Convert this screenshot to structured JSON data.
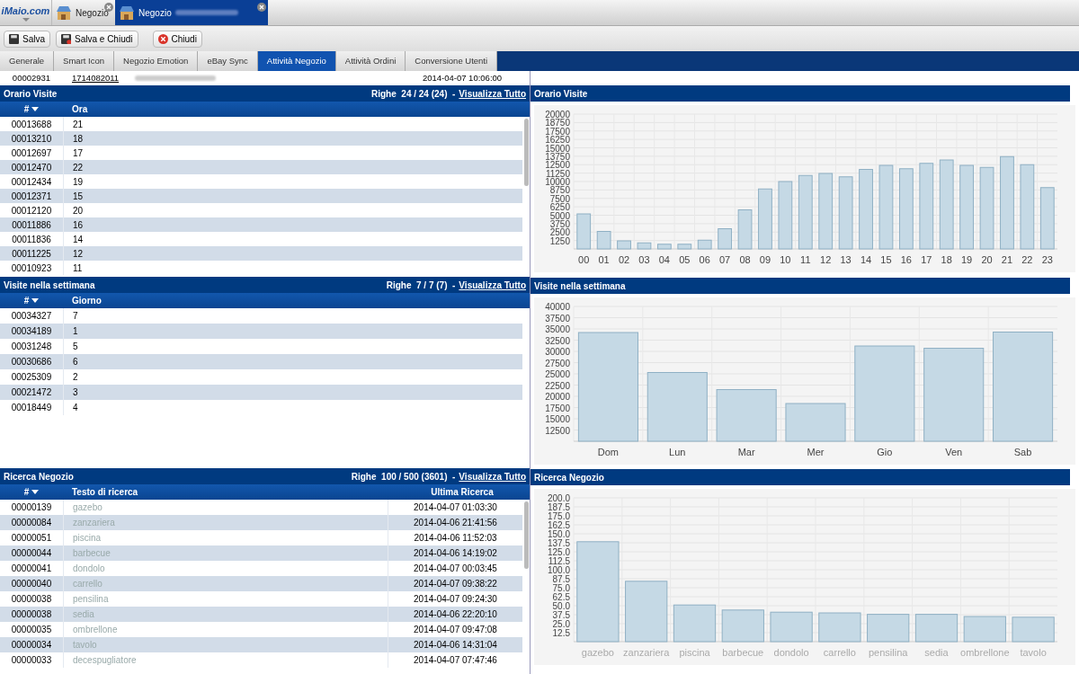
{
  "app_tabs": [
    {
      "brand": "iMaio.com"
    },
    {
      "label": "Negozio",
      "selected": false
    },
    {
      "label": "Negozio",
      "selected": true
    }
  ],
  "toolbar": [
    "Salva",
    "Salva e Chiudi",
    "Chiudi"
  ],
  "tabs": [
    {
      "label": "Generale",
      "selected": false
    },
    {
      "label": "Smart Icon",
      "selected": false
    },
    {
      "label": "Negozio Emotion",
      "selected": false
    },
    {
      "label": "eBay Sync",
      "selected": false
    },
    {
      "label": "Attività Negozio",
      "selected": true
    },
    {
      "label": "Attività Ordini",
      "selected": false
    },
    {
      "label": "Conversione Utenti",
      "selected": false
    }
  ],
  "top_row": {
    "id": "00002931",
    "order": "1714082011",
    "date": "2014-04-07 10:06:00"
  },
  "sections": [
    {
      "title": "Orario Visite",
      "count": "Righe  24 / 24 (24)  -",
      "link": "Visualizza Tutto",
      "columns": [
        "#",
        "Ora"
      ],
      "rows": [
        [
          "00013688",
          "21"
        ],
        [
          "00013210",
          "18"
        ],
        [
          "00012697",
          "17"
        ],
        [
          "00012470",
          "22"
        ],
        [
          "00012434",
          "19"
        ],
        [
          "00012371",
          "15"
        ],
        [
          "00012120",
          "20"
        ],
        [
          "00011886",
          "16"
        ],
        [
          "00011836",
          "14"
        ],
        [
          "00011225",
          "12"
        ],
        [
          "00010923",
          "11"
        ]
      ],
      "chart_title": "Orario Visite",
      "chart_data": {
        "type": "bar",
        "categories": [
          "00",
          "01",
          "02",
          "03",
          "04",
          "05",
          "06",
          "07",
          "08",
          "09",
          "10",
          "11",
          "12",
          "13",
          "14",
          "15",
          "16",
          "17",
          "18",
          "19",
          "20",
          "21",
          "22",
          "23"
        ],
        "grid": true,
        "series": [
          {
            "color": "#c5d9e5",
            "values": [
              5200,
              2600,
              1200,
              900,
              700,
              700,
              1300,
              3000,
              5800,
              8900,
              10000,
              10900,
              11200,
              10700,
              11800,
              12400,
              11900,
              12700,
              13200,
              12400,
              12100,
              13700,
              12500,
              9100
            ]
          }
        ],
        "ylim": [
          0,
          20000
        ],
        "yticks": [
          1250,
          2500,
          3750,
          5000,
          6250,
          7500,
          8750,
          10000,
          11250,
          12500,
          13750,
          15000,
          16250,
          17500,
          18750,
          20000
        ]
      }
    },
    {
      "title": "Visite nella settimana",
      "count": "Righe  7 / 7 (7)  -",
      "link": "Visualizza Tutto",
      "columns": [
        "#",
        "Giorno"
      ],
      "rows": [
        [
          "00034327",
          "7"
        ],
        [
          "00034189",
          "1"
        ],
        [
          "00031248",
          "5"
        ],
        [
          "00030686",
          "6"
        ],
        [
          "00025309",
          "2"
        ],
        [
          "00021472",
          "3"
        ],
        [
          "00018449",
          "4"
        ]
      ],
      "chart_title": "Visite nella settimana",
      "chart_data": {
        "type": "bar",
        "categories": [
          "Dom",
          "Lun",
          "Mar",
          "Mer",
          "Gio",
          "Ven",
          "Sab"
        ],
        "grid": true,
        "series": [
          {
            "color": "#c5d9e5",
            "values": [
              34200,
              25300,
              21500,
              18400,
              31200,
              30700,
              34300
            ]
          }
        ],
        "ylim": [
          10000,
          40000
        ],
        "yticks": [
          12500,
          15000,
          17500,
          20000,
          22500,
          25000,
          27500,
          30000,
          32500,
          35000,
          37500,
          40000
        ]
      }
    },
    {
      "title": "Ricerca Negozio",
      "count": "Righe  100 / 500 (3601)  -",
      "link": "Visualizza Tutto",
      "columns": [
        "#",
        "Testo di ricerca",
        "Ultima Ricerca"
      ],
      "rows": [
        [
          "00000139",
          "gazebo",
          "2014-04-07 01:03:30"
        ],
        [
          "00000084",
          "zanzariera",
          "2014-04-06 21:41:56"
        ],
        [
          "00000051",
          "piscina",
          "2014-04-06 11:52:03"
        ],
        [
          "00000044",
          "barbecue",
          "2014-04-06 14:19:02"
        ],
        [
          "00000041",
          "dondolo",
          "2014-04-07 00:03:45"
        ],
        [
          "00000040",
          "carrello",
          "2014-04-07 09:38:22"
        ],
        [
          "00000038",
          "pensilina",
          "2014-04-07 09:24:30"
        ],
        [
          "00000038",
          "sedia",
          "2014-04-06 22:20:10"
        ],
        [
          "00000035",
          "ombrellone",
          "2014-04-07 09:47:08"
        ],
        [
          "00000034",
          "tavolo",
          "2014-04-06 14:31:04"
        ],
        [
          "00000033",
          "decespugliatore",
          "2014-04-07 07:47:46"
        ]
      ],
      "chart_title": "Ricerca Negozio",
      "chart_data": {
        "type": "bar",
        "categories": [
          "gazebo",
          "zanzariera",
          "piscina",
          "barbecue",
          "dondolo",
          "carrello",
          "pensilina",
          "sedia",
          "ombrellone",
          "tavolo"
        ],
        "grid": true,
        "series": [
          {
            "color": "#c5d9e5",
            "values": [
              139,
              84,
              51,
              44,
              41,
              40,
              38,
              38,
              35,
              34
            ]
          }
        ],
        "ylim": [
          0,
          200
        ],
        "yticks": [
          {
            "value": 12.5,
            "label": "12.5"
          },
          {
            "value": 25,
            "label": "25.0"
          },
          {
            "value": 37.5,
            "label": "37.5"
          },
          {
            "value": 50,
            "label": "50.0"
          },
          {
            "value": 62.5,
            "label": "62.5"
          },
          {
            "value": 75,
            "label": "75.0"
          },
          {
            "value": 87.5,
            "label": "87.5"
          },
          {
            "value": 100,
            "label": "100.0"
          },
          {
            "value": 112.5,
            "label": "112.5"
          },
          {
            "value": 125,
            "label": "125.0"
          },
          {
            "value": 137.5,
            "label": "137.5"
          },
          {
            "value": 150,
            "label": "150.0"
          },
          {
            "value": 162.5,
            "label": "162.5"
          },
          {
            "value": 175,
            "label": "175.0"
          },
          {
            "value": 187.5,
            "label": "187.5"
          },
          {
            "value": 200,
            "label": "200.0"
          }
        ]
      }
    }
  ]
}
